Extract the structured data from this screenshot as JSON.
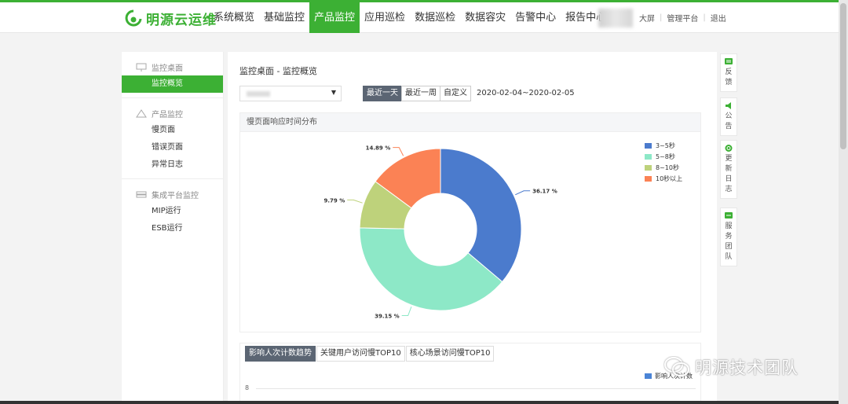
{
  "app": {
    "logo_text": "明源云运维"
  },
  "nav": {
    "items": [
      "系统概览",
      "基础监控",
      "产品监控",
      "应用巡检",
      "数据巡检",
      "数据容灾",
      "告警中心",
      "报告中心"
    ],
    "active_index": 2,
    "right_links": [
      "大屏",
      "管理平台",
      "退出"
    ]
  },
  "sidebar": {
    "groups": [
      {
        "label": "监控桌面",
        "icon": "monitor-icon",
        "items": [
          "监控概览"
        ]
      },
      {
        "label": "产品监控",
        "icon": "triangle-nodes-icon",
        "items": [
          "慢页面",
          "错误页面",
          "异常日志"
        ]
      },
      {
        "label": "集成平台监控",
        "icon": "server-icon",
        "items": [
          "MIP运行",
          "ESB运行"
        ]
      }
    ],
    "active_item": "监控概览"
  },
  "main": {
    "breadcrumb": "监控桌面 - 监控概览",
    "range_buttons": [
      "最近一天",
      "最近一周",
      "自定义"
    ],
    "active_range": "最近一天",
    "date_range": "2020-02-04~2020-02-05",
    "panel1_title": "慢页面响应时间分布",
    "panel2_tabs": [
      "影响人次计数趋势",
      "关键用户访问慢TOP10",
      "核心场景访问慢TOP10"
    ],
    "panel2_active_tab": "影响人次计数趋势",
    "panel2_legend": "影响人次计数",
    "panel2_ytick": "8"
  },
  "right_tools": [
    {
      "label": "反馈",
      "icon": "feedback-icon",
      "color": "#3cb034"
    },
    {
      "label": "公告",
      "icon": "speaker-icon",
      "color": "#3cb034"
    },
    {
      "label": "更新日志",
      "icon": "refresh-icon",
      "color": "#3cb034"
    },
    {
      "label": "服务团队",
      "icon": "team-icon",
      "color": "#3cb034"
    }
  ],
  "watermark": "明源技术团队",
  "colors": {
    "accent": "#3cb034",
    "button_active": "#5b6573"
  },
  "chart_data": {
    "type": "pie",
    "donut": true,
    "title": "慢页面响应时间分布",
    "categories": [
      "3~5秒",
      "5~8秒",
      "8~10秒",
      "10秒以上"
    ],
    "values": [
      36.17,
      39.15,
      9.79,
      14.89
    ],
    "labels": [
      "36.17 %",
      "39.15 %",
      "9.79 %",
      "14.89 %"
    ],
    "colors": [
      "#4b7bcd",
      "#8de8c7",
      "#bed27b",
      "#fb8255"
    ],
    "legend_position": "top-right"
  }
}
